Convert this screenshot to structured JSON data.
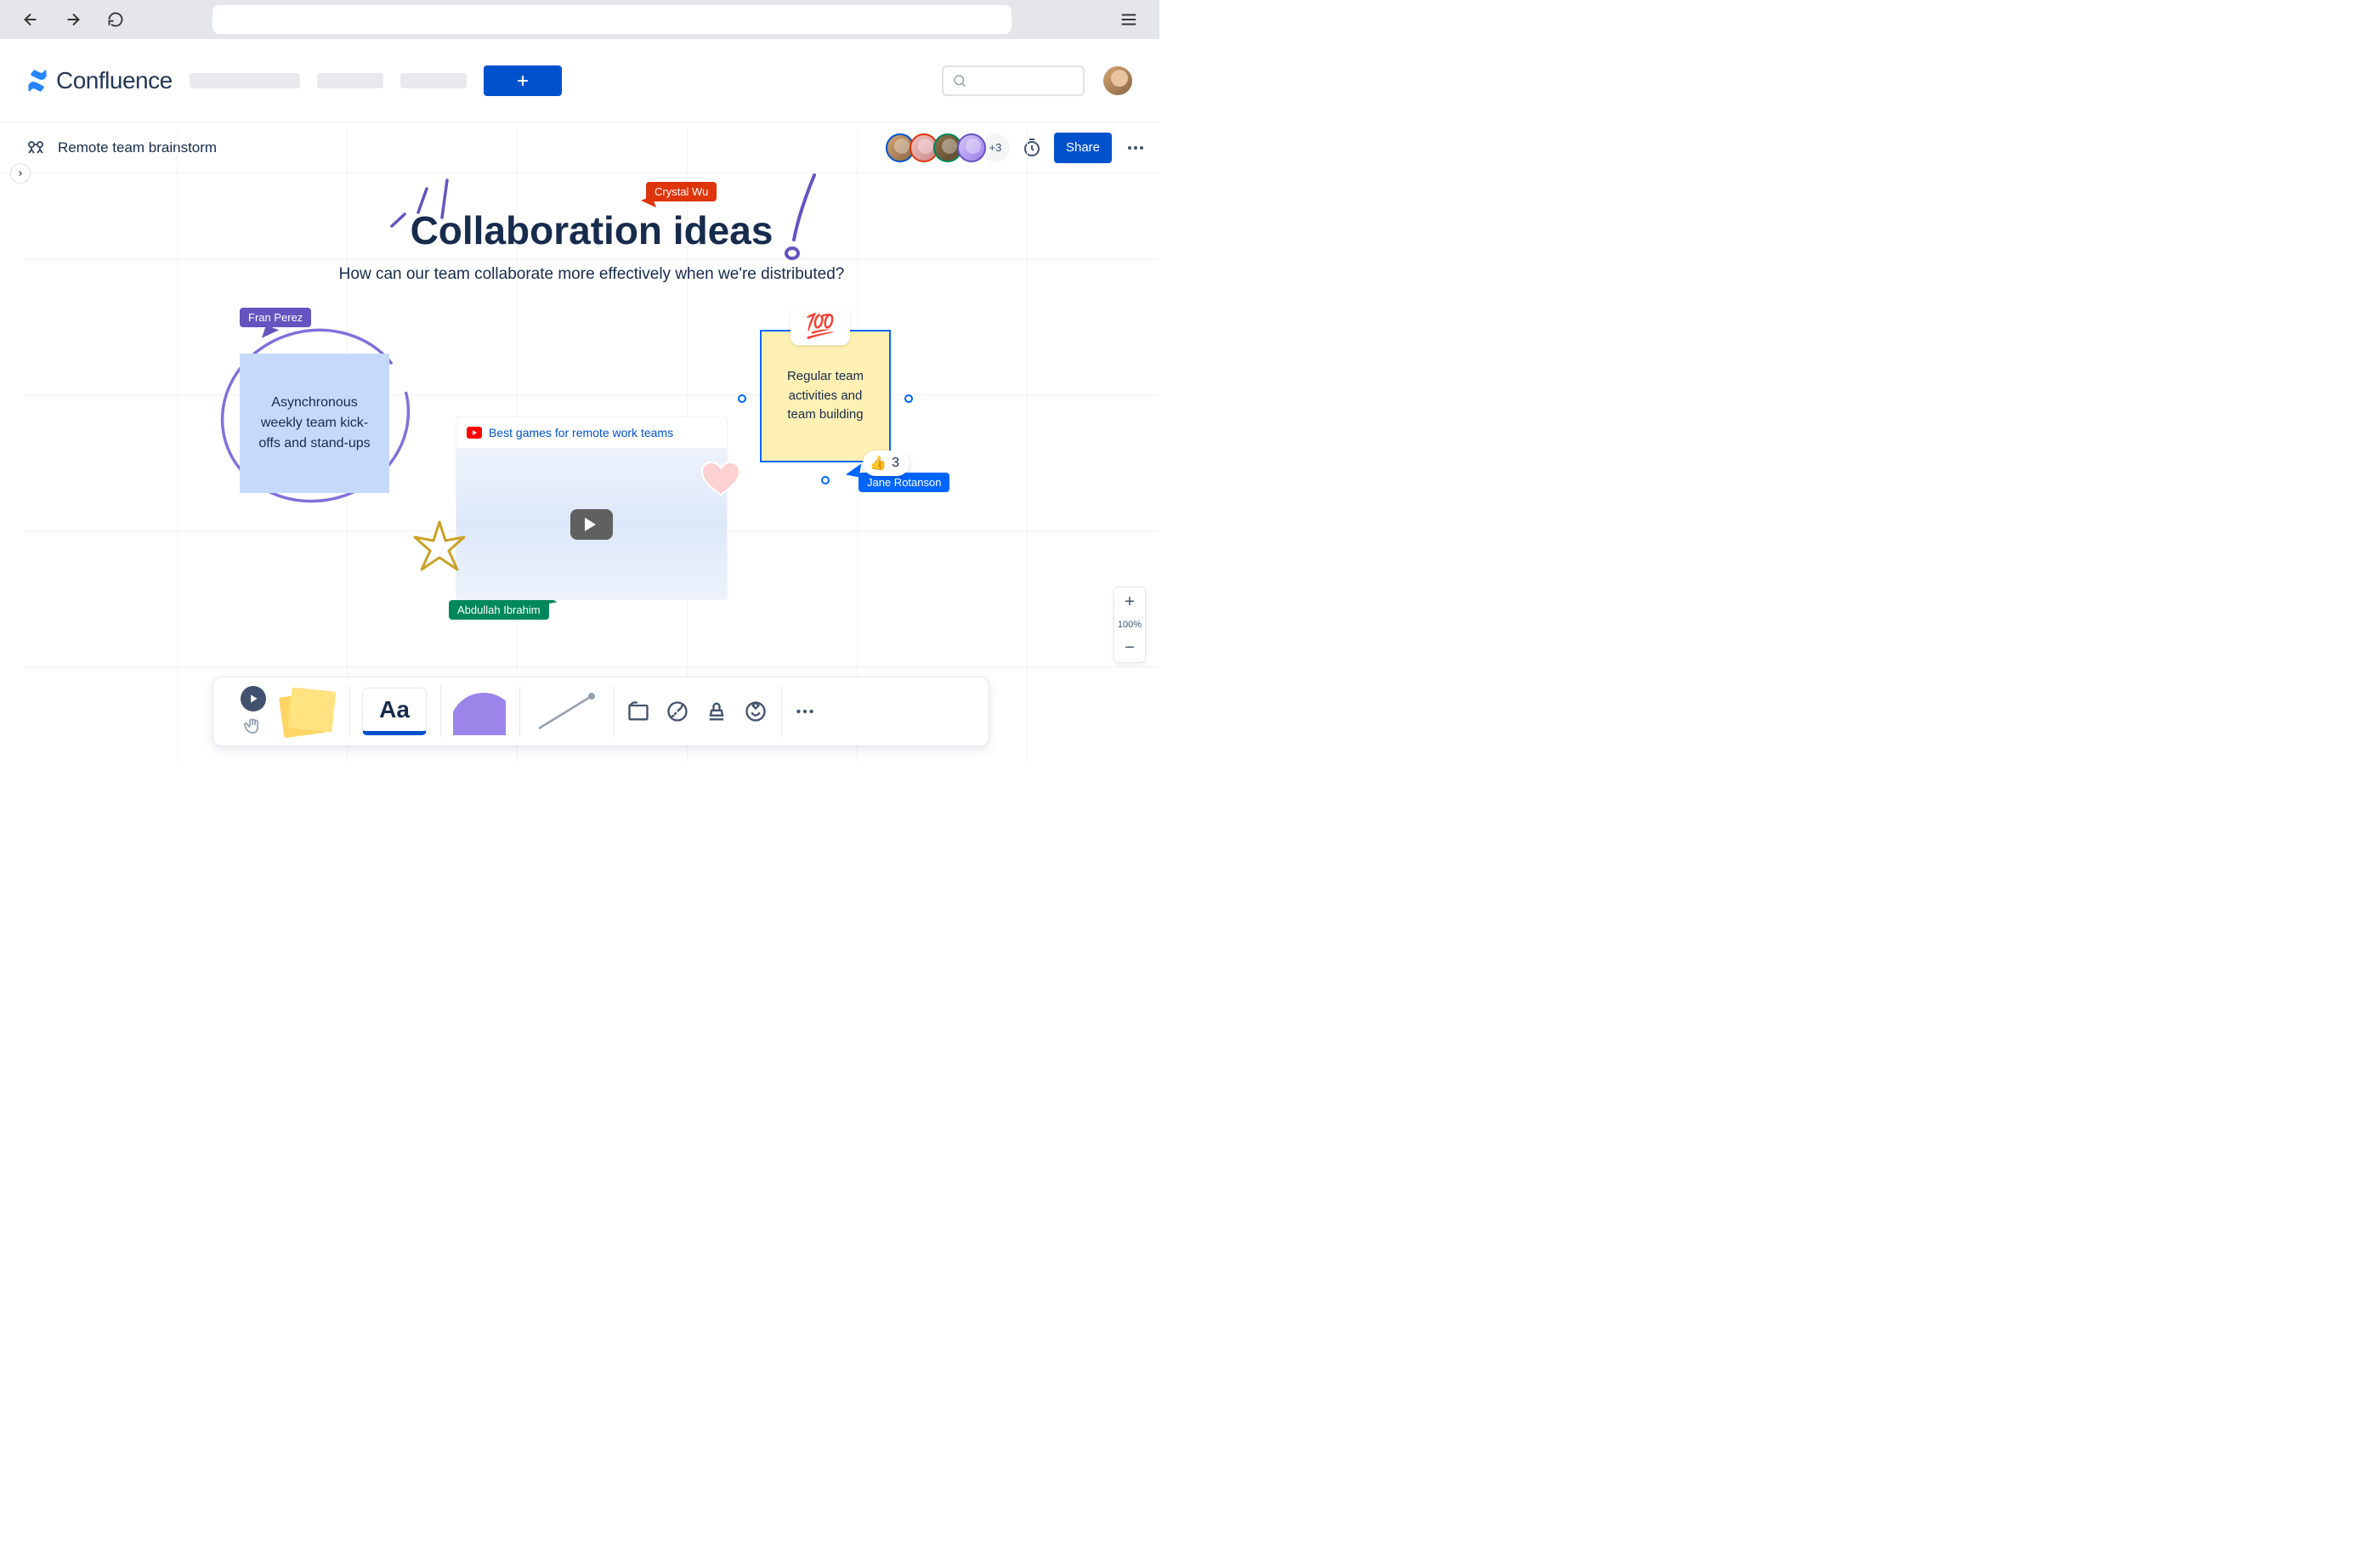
{
  "app": {
    "name": "Confluence"
  },
  "header": {
    "page_title": "Remote team brainstorm",
    "presence_overflow": "+3",
    "share_label": "Share"
  },
  "board": {
    "title": "Collaboration ideas",
    "subtitle": "How can our team collaborate more effectively when we're distributed?"
  },
  "cursors": {
    "red": "Crystal Wu",
    "purple": "Fran Perez",
    "green": "Abdullah Ibrahim",
    "blue": "Jane Rotanson"
  },
  "stickies": {
    "blue": "Asynchronous weekly team kick-offs and stand-ups",
    "yellow": "Regular team activities and team building",
    "yellow_reactions": "3",
    "hundred_emoji": "💯",
    "thumb_emoji": "👍"
  },
  "video": {
    "title": "Best games for remote work teams"
  },
  "toolbar": {
    "text_label": "Aa"
  },
  "zoom": {
    "level": "100%",
    "plus": "+",
    "minus": "−"
  }
}
